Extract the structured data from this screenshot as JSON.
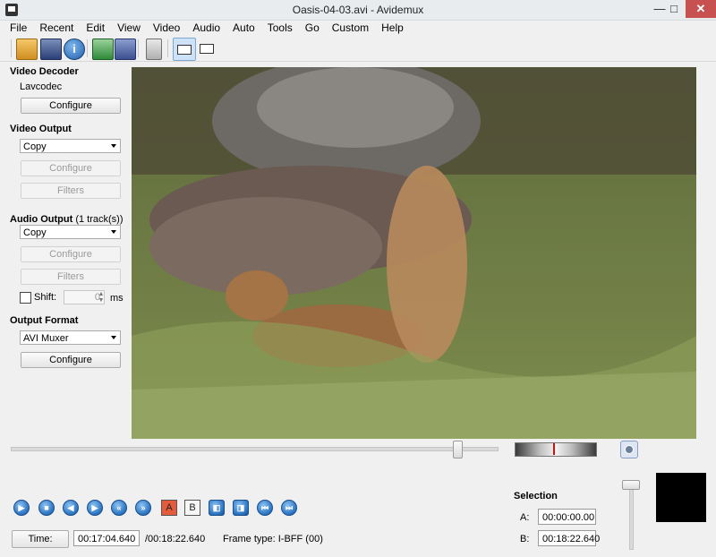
{
  "window": {
    "title": "Oasis-04-03.avi - Avidemux",
    "minimize": "—",
    "maximize": "□",
    "close": "✕"
  },
  "menu": [
    "File",
    "Recent",
    "Edit",
    "View",
    "Video",
    "Audio",
    "Auto",
    "Tools",
    "Go",
    "Custom",
    "Help"
  ],
  "toolbar": {
    "icons": [
      "open-icon",
      "save-icon",
      "info-icon",
      "open-video-icon",
      "save-video-icon",
      "calculator-icon",
      "input-view-icon",
      "output-view-icon"
    ]
  },
  "video_decoder": {
    "title": "Video Decoder",
    "codec": "Lavcodec",
    "configure": "Configure"
  },
  "video_output": {
    "title": "Video Output",
    "selected": "Copy",
    "configure": "Configure",
    "filters": "Filters"
  },
  "audio_output": {
    "title": "Audio Output",
    "tracks": "(1 track(s))",
    "selected": "Copy",
    "configure": "Configure",
    "filters": "Filters",
    "shift_label": "Shift:",
    "shift_value": "0",
    "shift_unit": "ms"
  },
  "output_format": {
    "title": "Output Format",
    "selected": "AVI Muxer",
    "configure": "Configure"
  },
  "playback": {
    "marker_a": "A",
    "marker_b": "B"
  },
  "status": {
    "time_button": "Time:",
    "current_time": "00:17:04.640",
    "total_time": "/00:18:22.640",
    "frame_type": "Frame type:  I-BFF (00)"
  },
  "selection": {
    "title": "Selection",
    "a_label": "A:",
    "a_value": "00:00:00.00",
    "b_label": "B:",
    "b_value": "00:18:22.640"
  },
  "seek": {
    "position": 0.917
  },
  "colors": {
    "close_button": "#c75050",
    "accent_blue": "#2f78c4",
    "jog_marker": "#d01010"
  }
}
